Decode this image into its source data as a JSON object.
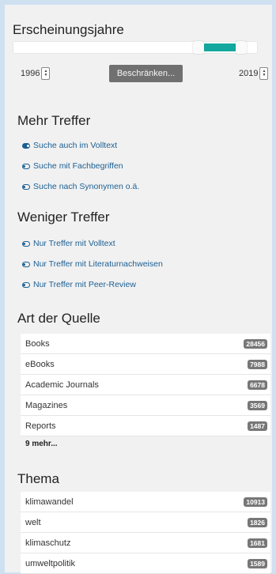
{
  "years": {
    "title": "Erscheinungsjahre",
    "from": "1996",
    "to": "2019",
    "apply_label": "Beschränken...",
    "range_start_fraction": 0.88,
    "range_end_fraction": 1.0
  },
  "more_results": {
    "title": "Mehr Treffer",
    "options": [
      {
        "label": "Suche auch im Volltext",
        "on": true
      },
      {
        "label": "Suche mit Fachbegriffen",
        "on": false
      },
      {
        "label": "Suche nach Synonymen o.ä.",
        "on": false
      }
    ]
  },
  "fewer_results": {
    "title": "Weniger Treffer",
    "options": [
      {
        "label": "Nur Treffer mit Volltext",
        "on": false
      },
      {
        "label": "Nur Treffer mit Literaturnachweisen",
        "on": false
      },
      {
        "label": "Nur Treffer mit Peer-Review",
        "on": false
      }
    ]
  },
  "source_type": {
    "title": "Art der Quelle",
    "items": [
      {
        "label": "Books",
        "count": "28456"
      },
      {
        "label": "eBooks",
        "count": "7988"
      },
      {
        "label": "Academic Journals",
        "count": "6678"
      },
      {
        "label": "Magazines",
        "count": "3569"
      },
      {
        "label": "Reports",
        "count": "1487"
      }
    ],
    "more_label": "9 mehr..."
  },
  "topic": {
    "title": "Thema",
    "items": [
      {
        "label": "klimawandel",
        "count": "10913"
      },
      {
        "label": "welt",
        "count": "1826"
      },
      {
        "label": "klimaschutz",
        "count": "1681"
      },
      {
        "label": "umweltpolitik",
        "count": "1589"
      }
    ]
  },
  "colors": {
    "accent": "#13a89e",
    "link": "#1b5f93",
    "badge": "#777777",
    "page_bg": "#cfe0f1"
  }
}
